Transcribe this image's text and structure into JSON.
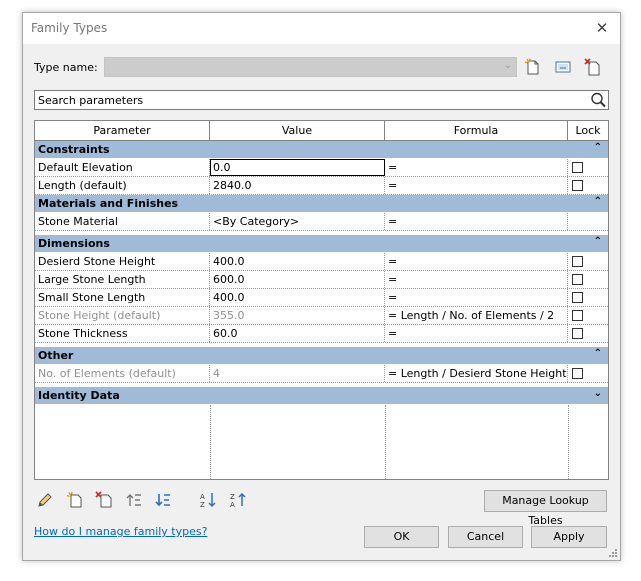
{
  "dialog": {
    "title": "Family Types",
    "close_glyph": "✕"
  },
  "type_name": {
    "label": "Type name:",
    "value": ""
  },
  "toolbar_icons": [
    "new-type-icon",
    "rename-type-icon",
    "delete-type-icon"
  ],
  "search": {
    "placeholder": "Search parameters",
    "icon": "magnifier-icon"
  },
  "table": {
    "columns": [
      "Parameter",
      "Value",
      "Formula",
      "Lock"
    ],
    "groups": [
      {
        "name": "Constraints",
        "toggle": "⌃",
        "rows": [
          {
            "param": "Default Elevation",
            "value": "0.0",
            "formula": "=",
            "lock": true,
            "dim": false,
            "active": true
          },
          {
            "param": "Length (default)",
            "value": "2840.0",
            "formula": "=",
            "lock": true,
            "dim": false
          }
        ]
      },
      {
        "name": "Materials and Finishes",
        "toggle": "⌃",
        "rows": [
          {
            "param": "Stone Material",
            "value": "<By Category>",
            "formula": "=",
            "lock": false,
            "dim": false
          }
        ]
      },
      {
        "name": "Dimensions",
        "toggle": "⌃",
        "rows": [
          {
            "param": "Desierd Stone Height",
            "value": "400.0",
            "formula": "=",
            "lock": true,
            "dim": false
          },
          {
            "param": "Large Stone Length",
            "value": "600.0",
            "formula": "=",
            "lock": true,
            "dim": false
          },
          {
            "param": "Small Stone Length",
            "value": "400.0",
            "formula": "=",
            "lock": true,
            "dim": false
          },
          {
            "param": "Stone Height (default)",
            "value": "355.0",
            "formula": "= Length / No. of Elements / 2",
            "lock": true,
            "dim": true
          },
          {
            "param": "Stone Thickness",
            "value": "60.0",
            "formula": "=",
            "lock": true,
            "dim": false
          }
        ]
      },
      {
        "name": "Other",
        "toggle": "⌃",
        "rows": [
          {
            "param": "No. of Elements (default)",
            "value": "4",
            "formula": "= Length / Desierd Stone Height /",
            "lock": true,
            "dim": true
          }
        ]
      },
      {
        "name": "Identity Data",
        "toggle": "⌄",
        "rows": []
      }
    ]
  },
  "bottom_toolbar_icons": [
    "edit-parameter-icon",
    "new-parameter-icon",
    "delete-parameter-icon",
    "move-up-icon",
    "move-down-icon",
    "sort-ascending-icon",
    "sort-descending-icon"
  ],
  "buttons": {
    "manage_lookup": "Manage Lookup Tables",
    "ok": "OK",
    "cancel": "Cancel",
    "apply": "Apply"
  },
  "help_link": "How do I manage family types?"
}
